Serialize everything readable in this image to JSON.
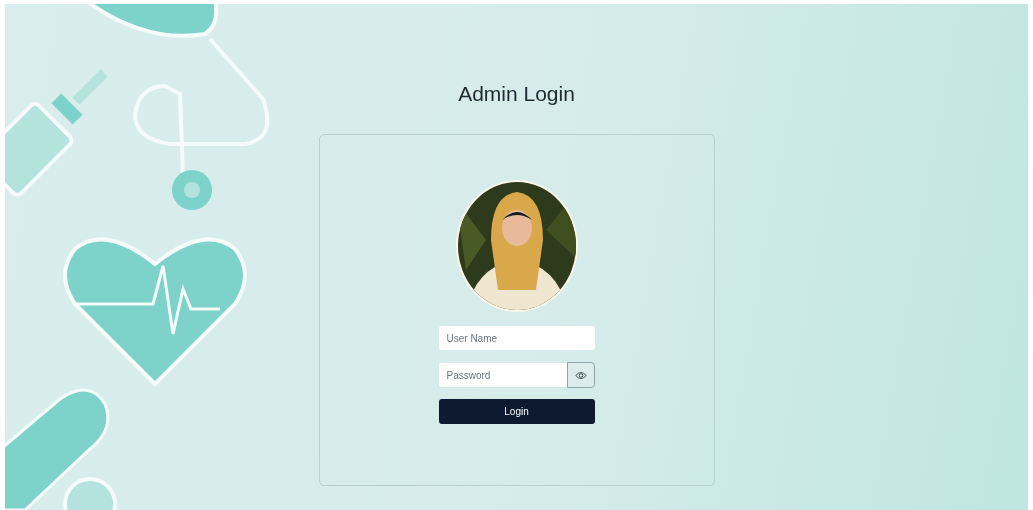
{
  "title": "Admin Login",
  "username_field": {
    "placeholder": "User Name"
  },
  "password_field": {
    "placeholder": "Password"
  },
  "login_button": {
    "label": "Login"
  }
}
